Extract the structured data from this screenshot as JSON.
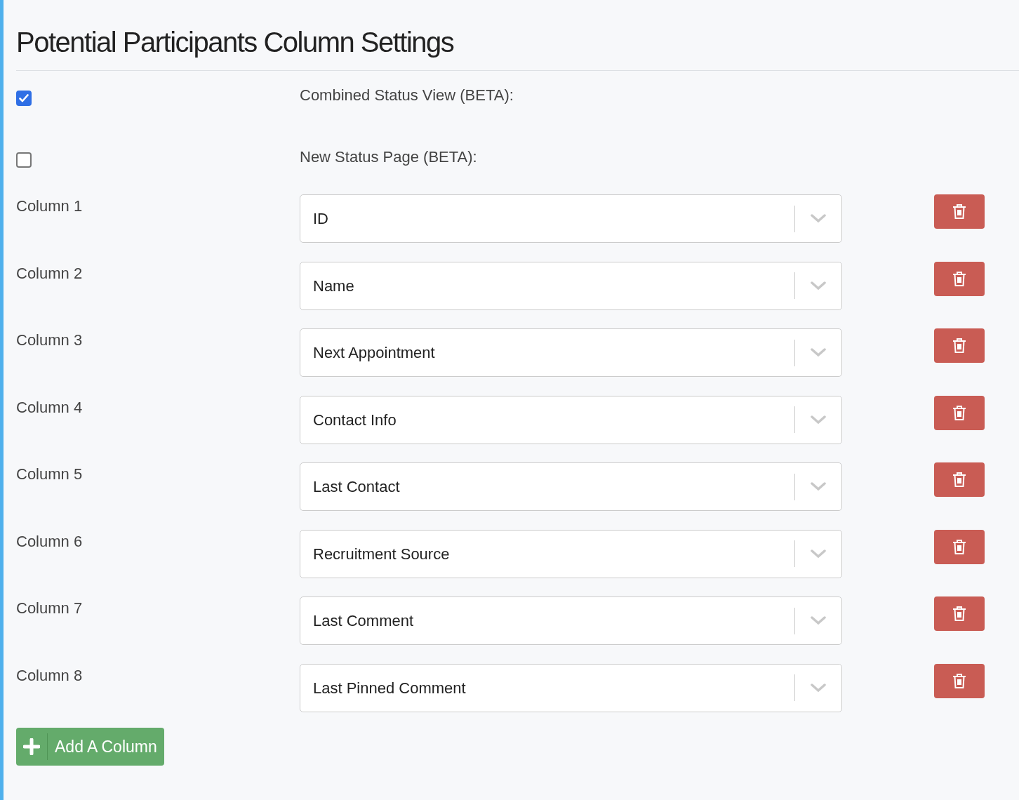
{
  "title": "Potential Participants Column Settings",
  "toggles": [
    {
      "label": "Combined Status View (BETA):",
      "checked": true
    },
    {
      "label": "New Status Page (BETA):",
      "checked": false
    }
  ],
  "columns": [
    {
      "label": "Column 1",
      "value": "ID"
    },
    {
      "label": "Column 2",
      "value": "Name"
    },
    {
      "label": "Column 3",
      "value": "Next Appointment"
    },
    {
      "label": "Column 4",
      "value": "Contact Info"
    },
    {
      "label": "Column 5",
      "value": "Last Contact"
    },
    {
      "label": "Column 6",
      "value": "Recruitment Source"
    },
    {
      "label": "Column 7",
      "value": "Last Comment"
    },
    {
      "label": "Column 8",
      "value": "Last Pinned Comment"
    }
  ],
  "add_button": "Add A Column"
}
